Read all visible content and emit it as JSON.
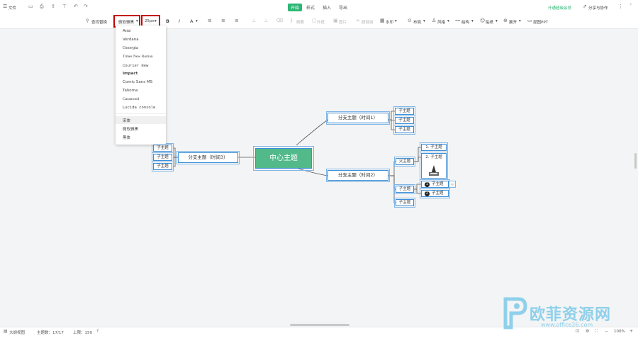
{
  "topbar": {
    "file_menu": "文件",
    "tabs": [
      "开始",
      "样式",
      "插入",
      "导出"
    ],
    "upgrade_label": "开通超级会员",
    "share_label": "分享与协作"
  },
  "toolbar": {
    "find_replace": "查找替换",
    "font_family": "微软雅黑",
    "font_size": "25px",
    "bold": "B",
    "italic": "I",
    "font_color": "A",
    "summary": "概要",
    "frame": "外框",
    "image": "图片",
    "hyperlink": "超链接",
    "more": "水印",
    "layout": "布局",
    "style": "风格",
    "structure": "结构",
    "sticker": "贴纸",
    "expand": "展开",
    "ppt": "提图PPT"
  },
  "font_menu": {
    "options": [
      "Arial",
      "Verdana",
      "Georgia",
      "Times New Roman",
      "Courier New",
      "Impact",
      "Comic Sans MS",
      "Tahoma",
      "Garamond",
      "Lucida console",
      "宋体",
      "微软雅黑",
      "黑体"
    ],
    "highlighted": "宋体"
  },
  "mindmap": {
    "center": "中心主题",
    "branch_time1": "分支主题（时间1）",
    "branch_time2": "分支主题（时间2）",
    "branch_time3": "分支主题（时间3）",
    "time1_children": [
      "子主题",
      "子主题",
      "子主题"
    ],
    "time3_children": [
      "子主题",
      "子主题",
      "子主题"
    ],
    "time2_parent_child": "父主题",
    "numbered_children": [
      "1. 子主题",
      "2. 子主题"
    ],
    "icon_children": [
      "子主题",
      "子主题"
    ],
    "time2_children": [
      "子主题",
      "子主题"
    ],
    "badge_1": "1",
    "badge_2": "2"
  },
  "status": {
    "outline_view": "大纲视图",
    "topic_count": "主题数：17/17",
    "limit": "上限：150",
    "zoom": "100%"
  },
  "watermark": {
    "brand": "欧菲资源网",
    "url": "www.office26.com"
  },
  "colors": {
    "accent_green": "#2bb673",
    "center_node": "#52b98a",
    "node_border": "#3c8fd8",
    "highlight_red": "#c40000"
  }
}
